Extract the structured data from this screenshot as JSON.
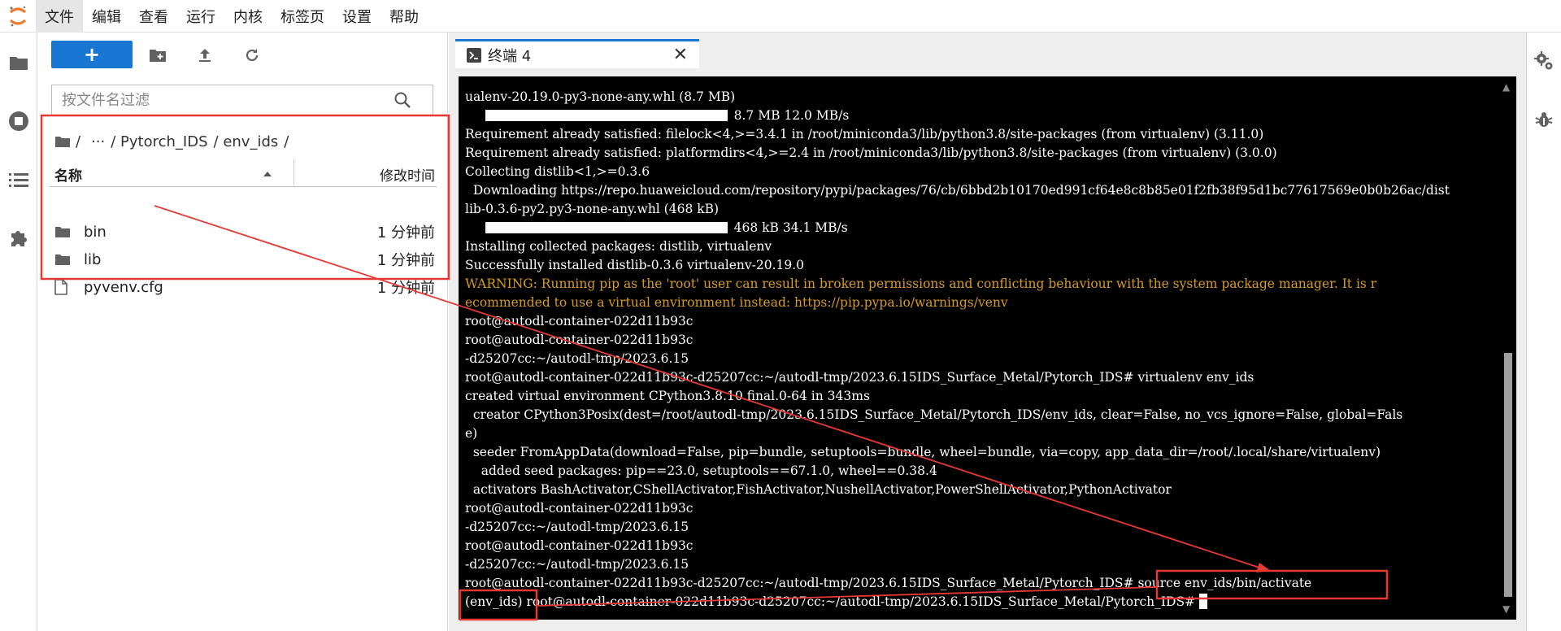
{
  "menubar": {
    "items": [
      "文件",
      "编辑",
      "查看",
      "运行",
      "内核",
      "标签页",
      "设置",
      "帮助"
    ]
  },
  "filebrowser": {
    "new_label": "+",
    "filter_placeholder": "按文件名过滤",
    "breadcrumb": [
      "/",
      "···",
      "/ Pytorch_IDS",
      "/ env_ids",
      "/"
    ],
    "columns": {
      "name": "名称",
      "modified": "修改时间"
    },
    "files": [
      {
        "name": "bin",
        "type": "folder",
        "modified": "1 分钟前"
      },
      {
        "name": "lib",
        "type": "folder",
        "modified": "1 分钟前"
      },
      {
        "name": "pyvenv.cfg",
        "type": "file",
        "modified": "1 分钟前"
      }
    ]
  },
  "tab": {
    "title": "终端 4"
  },
  "terminal": {
    "lines": [
      "ualenv-20.19.0-py3-none-any.whl (8.7 MB)",
      "     ",
      "Requirement already satisfied: filelock<4,>=3.4.1 in /root/miniconda3/lib/python3.8/site-packages (from virtualenv) (3.11.0)",
      "Requirement already satisfied: platformdirs<4,>=2.4 in /root/miniconda3/lib/python3.8/site-packages (from virtualenv) (3.0.0)",
      "Collecting distlib<1,>=0.3.6",
      "  Downloading https://repo.huaweicloud.com/repository/pypi/packages/76/cb/6bbd2b10170ed991cf64e8c8b85e01f2fb38f95d1bc77617569e0b0b26ac/dist",
      "lib-0.3.6-py2.py3-none-any.whl (468 kB)",
      "     ",
      "Installing collected packages: distlib, virtualenv",
      "Successfully installed distlib-0.3.6 virtualenv-20.19.0",
      "WARNING: Running pip as the 'root' user can result in broken permissions and conflicting behaviour with the system package manager. It is r",
      "ecommended to use a virtual environment instead: https://pip.pypa.io/warnings/venv",
      "root@autodl-container-022d11b93c",
      "root@autodl-container-022d11b93c",
      "-d25207cc:~/autodl-tmp/2023.6.15",
      "root@autodl-container-022d11b93c-d25207cc:~/autodl-tmp/2023.6.15IDS_Surface_Metal/Pytorch_IDS# virtualenv env_ids",
      "created virtual environment CPython3.8.10.final.0-64 in 343ms",
      "  creator CPython3Posix(dest=/root/autodl-tmp/2023.6.15IDS_Surface_Metal/Pytorch_IDS/env_ids, clear=False, no_vcs_ignore=False, global=Fals",
      "e)",
      "  seeder FromAppData(download=False, pip=bundle, setuptools=bundle, wheel=bundle, via=copy, app_data_dir=/root/.local/share/virtualenv)",
      "    added seed packages: pip==23.0, setuptools==67.1.0, wheel==0.38.4",
      "  activators BashActivator,CShellActivator,FishActivator,NushellActivator,PowerShellActivator,PythonActivator",
      "root@autodl-container-022d11b93c",
      "-d25207cc:~/autodl-tmp/2023.6.15",
      "root@autodl-container-022d11b93c",
      "-d25207cc:~/autodl-tmp/2023.6.15",
      "root@autodl-container-022d11b93c-d25207cc:~/autodl-tmp/2023.6.15IDS_Surface_Metal/Pytorch_IDS# source env_ids/bin/activate",
      "(env_ids) root@autodl-container-022d11b93c-d25207cc:~/autodl-tmp/2023.6.15IDS_Surface_Metal/Pytorch_IDS# "
    ],
    "progress": [
      {
        "line": 1,
        "fraction": 1.0,
        "stats": "8.7 MB 12.0 MB/s"
      },
      {
        "line": 7,
        "fraction": 1.0,
        "stats": "468 kB 34.1 MB/s"
      }
    ],
    "warning_lines": [
      10,
      11
    ],
    "warning_color": "#d79b22"
  },
  "colors": {
    "accent": "#1976d2",
    "annotation": "#e53935",
    "terminal_bg": "#000000"
  }
}
